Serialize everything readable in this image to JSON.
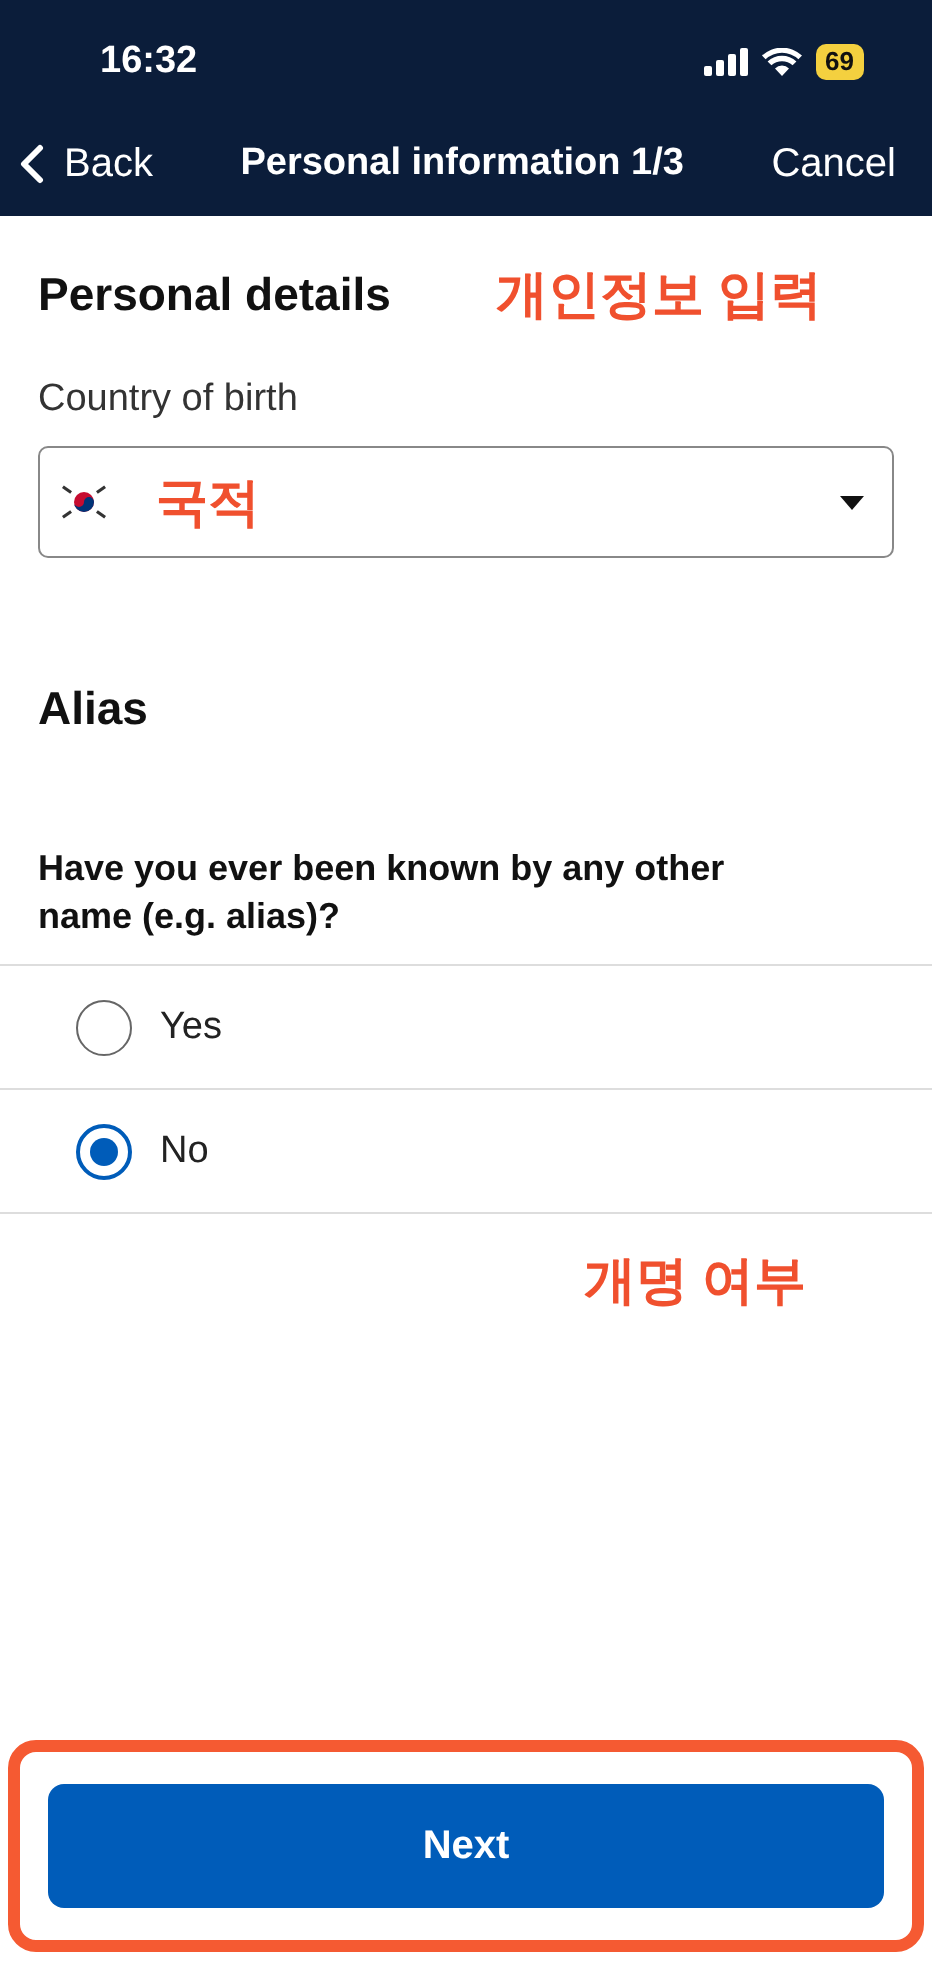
{
  "status_bar": {
    "time": "16:32",
    "battery": "69"
  },
  "nav": {
    "back": "Back",
    "title": "Personal information 1/3",
    "cancel": "Cancel"
  },
  "section": {
    "title": "Personal details",
    "annotation": "개인정보 입력"
  },
  "country": {
    "label": "Country of birth",
    "value": "국적"
  },
  "alias": {
    "title": "Alias",
    "question": "Have you ever been known by any other name (e.g. alias)?",
    "options": [
      {
        "label": "Yes",
        "selected": false
      },
      {
        "label": "No",
        "selected": true
      }
    ],
    "annotation": "개명 여부"
  },
  "next": {
    "label": "Next",
    "highlighted": true
  }
}
